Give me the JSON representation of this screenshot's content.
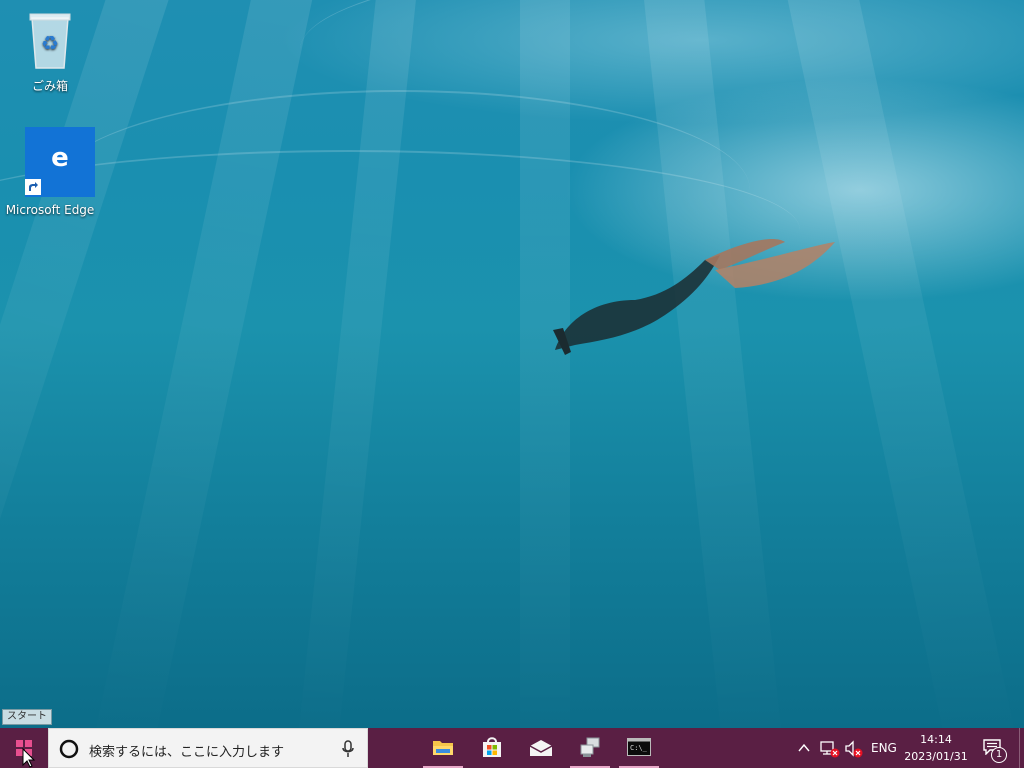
{
  "desktop": {
    "icons": [
      {
        "label": "ごみ箱",
        "icon": "recycle-bin-icon"
      },
      {
        "label": "Microsoft Edge",
        "icon": "edge-icon",
        "glyph": "e"
      }
    ]
  },
  "tooltip": {
    "text": "スタート"
  },
  "taskbar": {
    "start_icon": "windows-logo-icon",
    "search": {
      "placeholder": "検索するには、ここに入力します",
      "cortana_icon": "cortana-icon",
      "mic_icon": "microphone-icon"
    },
    "apps": [
      {
        "name": "File Explorer",
        "icon": "folder-icon",
        "active": true
      },
      {
        "name": "Microsoft Store",
        "icon": "store-icon",
        "active": false
      },
      {
        "name": "Mail",
        "icon": "mail-icon",
        "active": false
      },
      {
        "name": "Network app",
        "icon": "network-computers-icon",
        "active": true
      },
      {
        "name": "Command Prompt",
        "icon": "terminal-icon",
        "active": true
      }
    ],
    "tray": {
      "chevron_icon": "chevron-up-icon",
      "network_icon": "network-disconnected-icon",
      "volume_icon": "volume-muted-icon",
      "language": "ENG",
      "time": "14:14",
      "date": "2023/01/31",
      "notifications_icon": "action-center-icon",
      "notification_count": "1"
    },
    "colors": {
      "taskbar": "#5a1f44",
      "accent_underline": "#e7a8c8"
    }
  }
}
